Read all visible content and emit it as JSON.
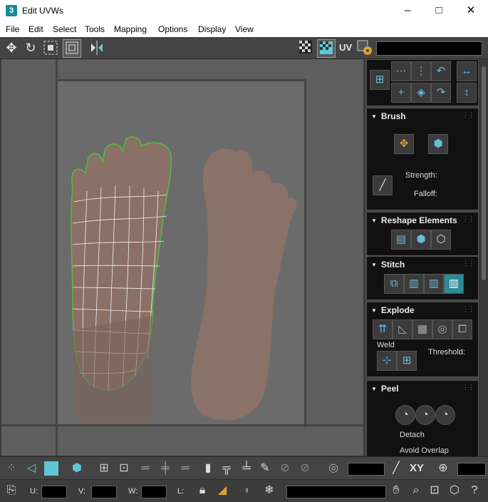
{
  "window": {
    "app_icon": "3",
    "title": "Edit UVWs",
    "minimize": "–",
    "maximize": "□",
    "close": "✕"
  },
  "menu": [
    "File",
    "Edit",
    "Select",
    "Tools",
    "Mapping",
    "Options",
    "Display",
    "View"
  ],
  "toolbar": {
    "uv_label": "UV"
  },
  "panels": {
    "brush": {
      "title": "Brush",
      "strength_label": "Strength:",
      "falloff_label": "Falloff:"
    },
    "reshape": {
      "title": "Reshape Elements"
    },
    "stitch": {
      "title": "Stitch"
    },
    "explode": {
      "title": "Explode",
      "weld_label": "Weld",
      "threshold_label": "Threshold:"
    },
    "peel": {
      "title": "Peel",
      "detach_label": "Detach",
      "avoid_overlap_label": "Avoid Overlap"
    }
  },
  "bottom": {
    "xy_label": "XY",
    "u_label": "U:",
    "v_label": "V:",
    "w_label": "W:",
    "l_label": "L:"
  },
  "colors": {
    "accent": "#5fc7d4",
    "selection_outline": "#4ec03c",
    "panel_bg": "#111111"
  },
  "icons": [
    "move-icon",
    "rotate-icon",
    "freeform-icon",
    "scale-icon",
    "mirror-icon",
    "checker-icon",
    "texture-icon",
    "settings-icon",
    "snap-icon",
    "brush-icon",
    "relax-icon",
    "stitch-icon",
    "explode-icon",
    "weld-icon",
    "peel-icon",
    "hand-icon",
    "zoom-icon",
    "lock-icon",
    "eye-icon",
    "snowflake-icon"
  ]
}
